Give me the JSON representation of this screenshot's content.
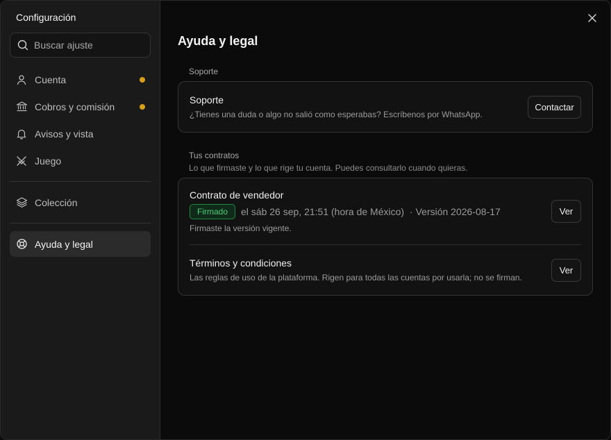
{
  "sidebar": {
    "title": "Configuración",
    "search_placeholder": "Buscar ajuste",
    "items": [
      {
        "label": "Cuenta",
        "icon": "user-icon",
        "dot": true
      },
      {
        "label": "Cobros y comisión",
        "icon": "bank-icon",
        "dot": true
      },
      {
        "label": "Avisos y vista",
        "icon": "bell-icon",
        "dot": false
      },
      {
        "label": "Juego",
        "icon": "swords-icon",
        "dot": false
      },
      {
        "label": "Colección",
        "icon": "layers-icon",
        "dot": false
      },
      {
        "label": "Ayuda y legal",
        "icon": "lifebuoy-icon",
        "dot": false,
        "active": true
      }
    ]
  },
  "main": {
    "title": "Ayuda y legal",
    "support_section": {
      "label": "Soporte",
      "row_title": "Soporte",
      "row_sub": "¿Tienes una duda o algo no salió como esperabas? Escríbenos por WhatsApp.",
      "button": "Contactar"
    },
    "contracts_section": {
      "label": "Tus contratos",
      "desc": "Lo que firmaste y lo que rige tu cuenta. Puedes consultarlo cuando quieras.",
      "seller": {
        "title": "Contrato de vendedor",
        "badge": "Firmado",
        "signed_at": "el sáb 26 sep, 21:51 (hora de México)",
        "version": "· Versión 2026-08-17",
        "note": "Firmaste la versión vigente.",
        "button": "Ver"
      },
      "terms": {
        "title": "Términos y condiciones",
        "sub": "Las reglas de uso de la plataforma. Rigen para todas las cuentas por usarla; no se firman.",
        "button": "Ver"
      }
    }
  },
  "colors": {
    "accent_dot": "#d4a017",
    "badge_green": "#4ad07a"
  }
}
